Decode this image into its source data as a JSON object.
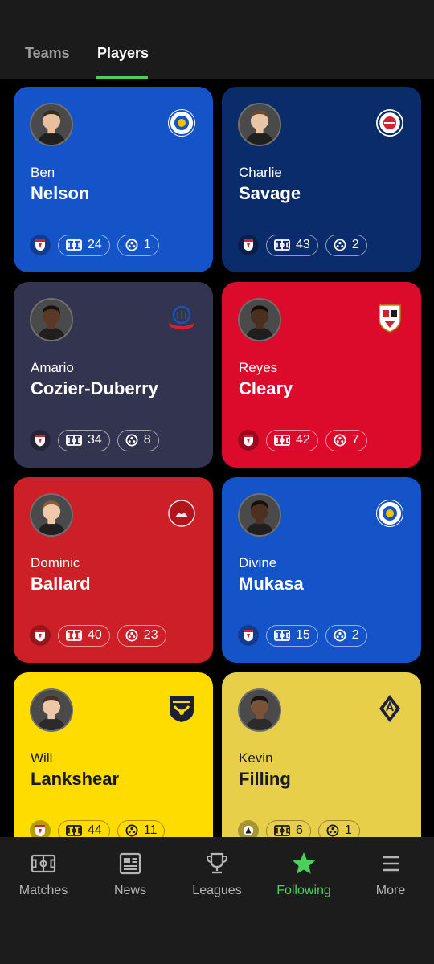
{
  "tabs": [
    {
      "label": "Teams",
      "active": false
    },
    {
      "label": "Players",
      "active": true
    }
  ],
  "accent_color": "#4ad15a",
  "players": [
    {
      "first": "Ben",
      "last": "Nelson",
      "matches": "24",
      "goals": "1",
      "bg": "#1553c9",
      "skin": "#e8c0a0",
      "hair": "#3a2a1c",
      "crest": "leicester-crest-icon",
      "league_icon": "efl-icon"
    },
    {
      "first": "Charlie",
      "last": "Savage",
      "matches": "43",
      "goals": "2",
      "bg": "#0b2c6b",
      "skin": "#e9c4a6",
      "hair": "#6b4a2e",
      "crest": "reading-crest-icon",
      "league_icon": "efl-icon"
    },
    {
      "first": "Amario",
      "last": "Cozier-Duberry",
      "matches": "34",
      "goals": "8",
      "bg": "#33344f",
      "skin": "#5a3a26",
      "hair": "#1a120c",
      "crest": "bolton-crest-icon",
      "league_icon": "efl-icon"
    },
    {
      "first": "Reyes",
      "last": "Cleary",
      "matches": "42",
      "goals": "7",
      "bg": "#dd0b2b",
      "skin": "#4a2e1e",
      "hair": "#140d08",
      "crest": "barnsley-crest-icon",
      "league_icon": "efl-icon"
    },
    {
      "first": "Dominic",
      "last": "Ballard",
      "matches": "40",
      "goals": "23",
      "bg": "#cd1f27",
      "skin": "#efc9aa",
      "hair": "#8a5a34",
      "crest": "leyton-orient-crest-icon",
      "league_icon": "efl-icon"
    },
    {
      "first": "Divine",
      "last": "Mukasa",
      "matches": "15",
      "goals": "2",
      "bg": "#1553c9",
      "skin": "#4d3020",
      "hair": "#140d08",
      "crest": "leicester-crest-icon",
      "league_icon": "efl-icon"
    },
    {
      "first": "Will",
      "last": "Lankshear",
      "matches": "44",
      "goals": "11",
      "bg": "#fedc00",
      "skin": "#ecc6a6",
      "hair": "#4a3020",
      "crest": "oxford-united-crest-icon",
      "league_icon": "efl-icon",
      "dark": true
    },
    {
      "first": "Kevin",
      "last": "Filling",
      "matches": "6",
      "goals": "1",
      "bg": "#e8cf4a",
      "skin": "#7a5238",
      "hair": "#1a120c",
      "crest": "aik-crest-icon",
      "league_icon": "allsvenskan-icon",
      "dark": true
    }
  ],
  "nav": [
    {
      "label": "Matches",
      "icon": "pitch-icon",
      "active": false
    },
    {
      "label": "News",
      "icon": "news-icon",
      "active": false
    },
    {
      "label": "Leagues",
      "icon": "trophy-icon",
      "active": false
    },
    {
      "label": "Following",
      "icon": "star-icon",
      "active": true
    },
    {
      "label": "More",
      "icon": "menu-icon",
      "active": false
    }
  ]
}
